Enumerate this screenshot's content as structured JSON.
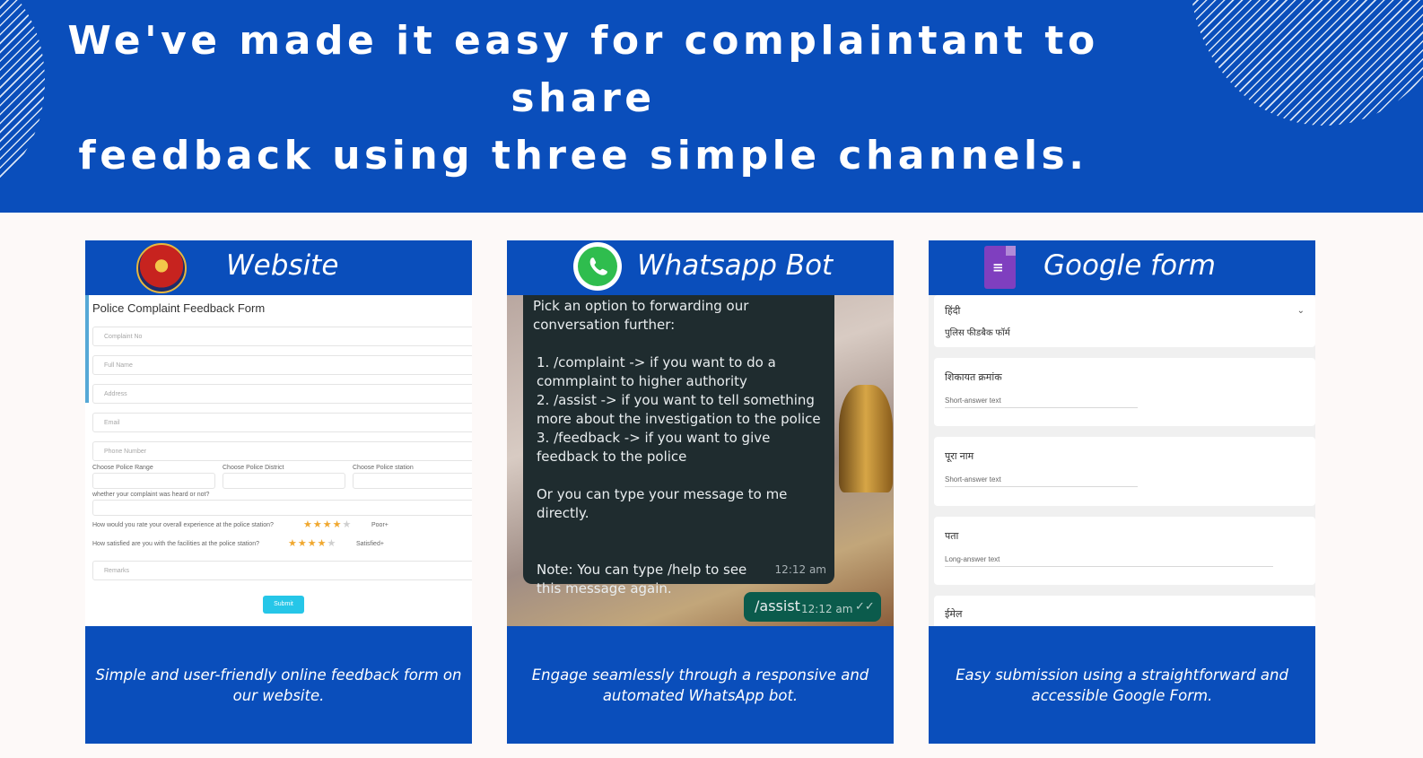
{
  "headline": {
    "line1": "We've made it easy for complaintant to share",
    "line2": "feedback using three simple channels."
  },
  "colors": {
    "brand_blue": "#0a4ebb",
    "whatsapp_green": "#2fbd4e",
    "forms_purple": "#7f3fbf"
  },
  "cards": {
    "website": {
      "title": "Website",
      "icon": "police-emblem-icon",
      "description": "Simple and user-friendly online feedback form on our website.",
      "form": {
        "title": "Police Complaint Feedback Form",
        "placeholders": [
          "Complaint No",
          "Full Name",
          "Address",
          "Email",
          "Phone Number"
        ],
        "range_label": "Choose Police Range",
        "district_label": "Choose Police District",
        "station_label": "Choose Police station",
        "heard_label": "whether your complaint was heard or not?",
        "experience_label": "How would you rate your overall experience at the police station?",
        "experience_stars": 3.5,
        "experience_value": "Poor+",
        "facilities_label": "How satisfied are you with the facilities at the police station?",
        "facilities_stars": 4,
        "facilities_value": "Satisfied+",
        "remarks_placeholder": "Remarks",
        "submit_label": "Submit"
      }
    },
    "whatsapp": {
      "title": "Whatsapp Bot",
      "icon": "whatsapp-icon",
      "description": "Engage seamlessly through a responsive and automated WhatsApp bot.",
      "bot_message": {
        "intro": "Pick an option to forwarding our conversation further:",
        "option1": "1. /complaint -> if you want to do a commplaint to higher authority",
        "option2": "2. /assist -> if you want to tell something more about the investigation to the police",
        "option3": "3. /feedback -> if you want to give feedback to the police",
        "direct": "Or you can type your message to me directly.",
        "note": "Note: You can type /help to see this message again.",
        "time": "12:12 am"
      },
      "user_reply": {
        "text": "/assist",
        "time": "12:12 am"
      }
    },
    "google_form": {
      "title": "Google form",
      "icon": "google-forms-icon",
      "description": "Easy submission using a straightforward and accessible Google Form.",
      "form": {
        "language": "हिंदी",
        "form_title": "पुलिस फीडबैक फॉर्म",
        "questions": [
          {
            "label": "शिकायत क्रमांक",
            "answer": "Short-answer text"
          },
          {
            "label": "पूरा नाम",
            "answer": "Short-answer text"
          },
          {
            "label": "पता",
            "answer": "Long-answer text"
          },
          {
            "label": "ईमेल",
            "answer": ""
          }
        ]
      }
    }
  }
}
